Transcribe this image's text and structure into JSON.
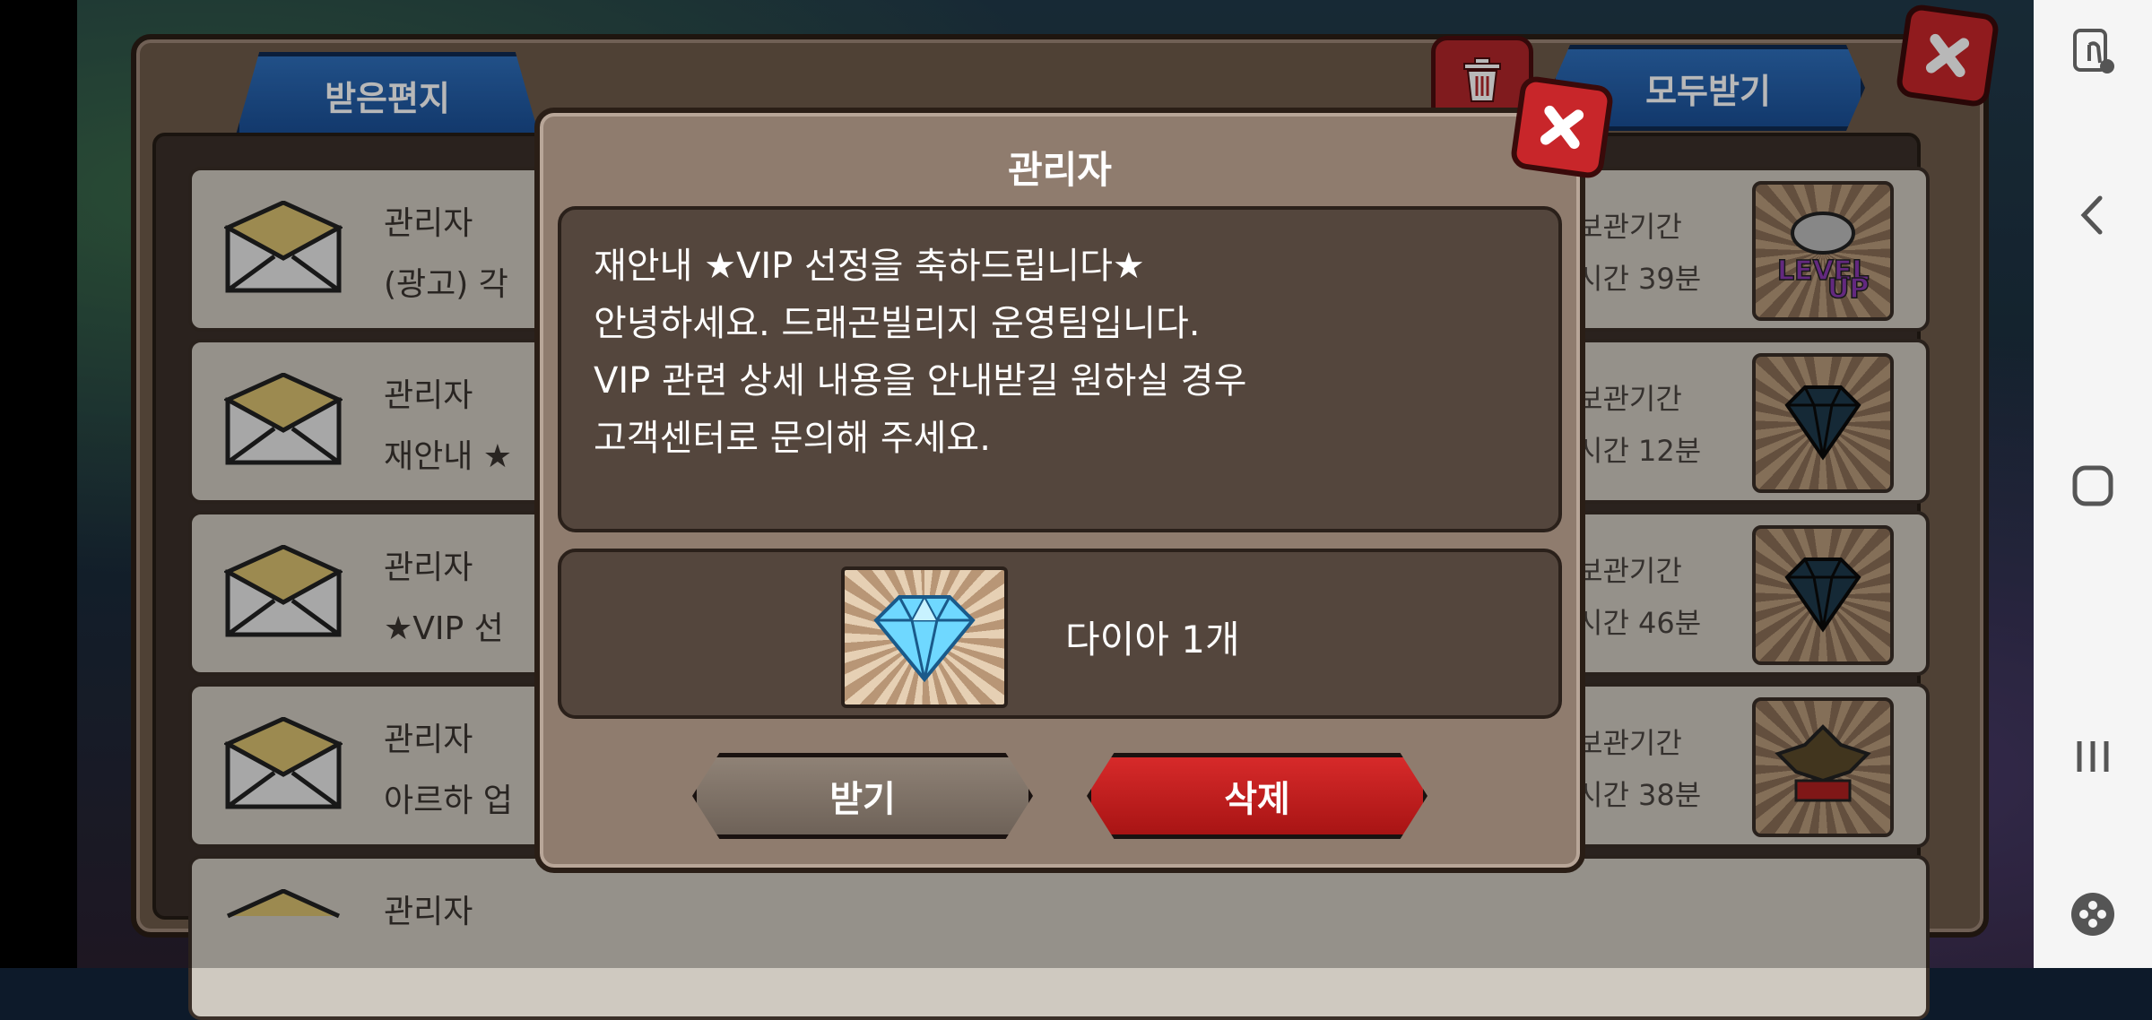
{
  "mail_window": {
    "tab_inbox_label": "받은편지",
    "receive_all_label": "모두받기"
  },
  "mail_rows": [
    {
      "sender": "관리자",
      "subject": "(광고) 각",
      "period_label": "보관기간",
      "remain": "시간 39분",
      "item_icon": "level-up-badge-icon"
    },
    {
      "sender": "관리자",
      "subject": "재안내 ★",
      "period_label": "보관기간",
      "remain": "시간 12분",
      "item_icon": "dark-diamond-icon"
    },
    {
      "sender": "관리자",
      "subject": "★VIP 선",
      "period_label": "보관기간",
      "remain": "시간 46분",
      "item_icon": "dark-diamond-icon"
    },
    {
      "sender": "관리자",
      "subject": "아르하 업",
      "period_label": "보관기간",
      "remain": "시간 38분",
      "item_icon": "bat-badge-icon"
    },
    {
      "sender": "관리자"
    }
  ],
  "modal": {
    "title": "관리자",
    "message_lines": [
      "재안내 ★VIP 선정을 축하드립니다★",
      "안녕하세요. 드래곤빌리지 운영팀입니다.",
      "VIP 관련 상세 내용을 안내받길 원하실 경우",
      "고객센터로 문의해 주세요."
    ],
    "reward_label": "다이아 1개",
    "receive_label": "받기",
    "delete_label": "삭제"
  },
  "colors": {
    "accent_blue": "#1a4f96",
    "delete_red": "#c21a1a",
    "panel_brown": "#8f7c6e"
  }
}
